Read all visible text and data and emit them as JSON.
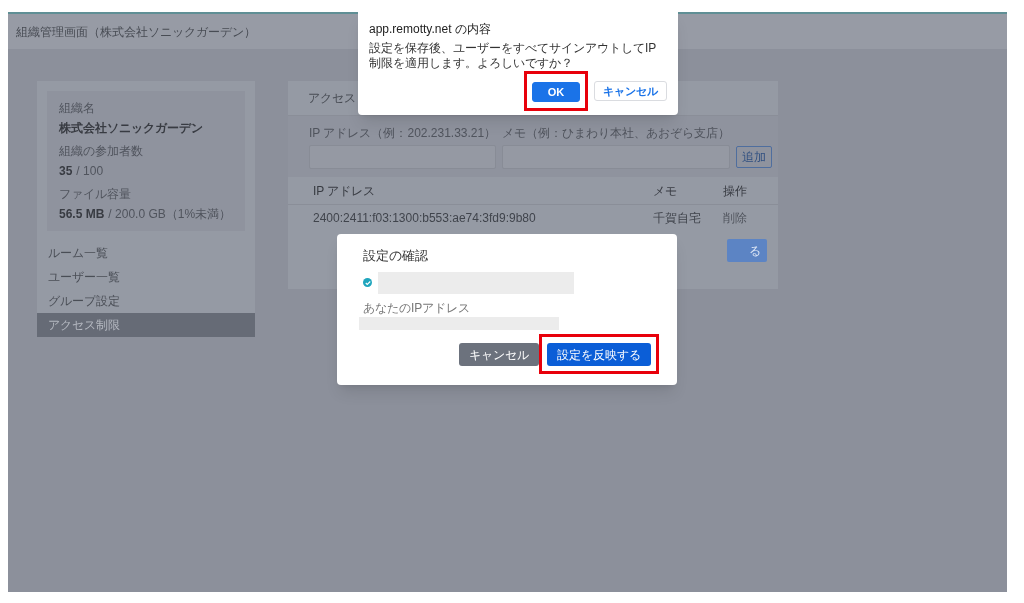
{
  "page": {
    "title": "組織管理画面（株式会社ソニックガーデン）"
  },
  "sidebar": {
    "org_label": "組織名",
    "org_name": "株式会社ソニックガーデン",
    "members_label": "組織の参加者数",
    "members_count": "35",
    "members_limit": "/ 100",
    "storage_label": "ファイル容量",
    "storage_used": "56.5 MB",
    "storage_limit": "/ 200.0 GB（1%未満）",
    "items": [
      {
        "label": "ルーム一覧",
        "selected": false
      },
      {
        "label": "ユーザー一覧",
        "selected": false
      },
      {
        "label": "グループ設定",
        "selected": false
      },
      {
        "label": "アクセス制限",
        "selected": true
      }
    ]
  },
  "access": {
    "heading": "アクセス",
    "ip_field": {
      "label": "IP アドレス（例：202.231.33.21）"
    },
    "memo_field": {
      "label": "メモ（例：ひまわり本社、あおぞら支店）"
    },
    "add_button": "追加",
    "columns": [
      "IP アドレス",
      "メモ",
      "操作"
    ],
    "rows": [
      {
        "ip": "2400:2411:f03:1300:b553:ae74:3fd9:9b80",
        "memo": "千賀自宅",
        "action": "削除"
      }
    ],
    "save_button": "る"
  },
  "confirm_dialog": {
    "title": "設定の確認",
    "checked": true,
    "ip_label": "あなたのIPアドレス",
    "buttons": [
      {
        "label": "キャンセル",
        "kind": "secondary",
        "highlighted": false
      },
      {
        "label": "設定を反映する",
        "kind": "primary",
        "highlighted": true
      }
    ]
  },
  "alert": {
    "title": "app.remotty.net の内容",
    "message": "設定を保存後、ユーザーをすべてサインアウトしてIP制限を適用します。よろしいですか？",
    "buttons": [
      {
        "label": "OK",
        "kind": "primary",
        "highlighted": true
      },
      {
        "label": "キャンセル",
        "kind": "secondary",
        "highlighted": false
      }
    ]
  }
}
